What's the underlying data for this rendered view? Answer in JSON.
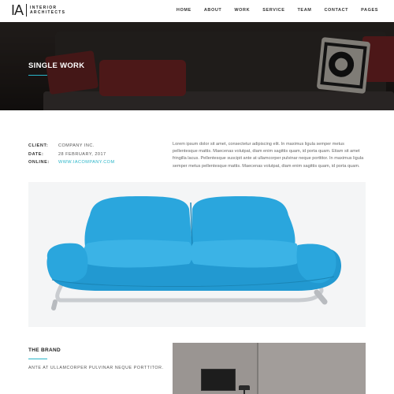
{
  "header": {
    "logo_mark": "IA",
    "logo_line1": "INTERIOR",
    "logo_line2": "ARCHITECTS",
    "nav": [
      "HOME",
      "ABOUT",
      "WORK",
      "SERVICE",
      "TEAM",
      "CONTACT",
      "PAGES"
    ]
  },
  "hero": {
    "title": "SINGLE WORK"
  },
  "project": {
    "client_label": "CLIENT:",
    "client_value": "COMPANY INC.",
    "date_label": "DATE:",
    "date_value": "28 FEBRUARY, 2017",
    "online_label": "ONLINE:",
    "online_value": "WWW.IACOMPANY.COM",
    "description": "Lorem ipsum dolor sit amet, consectetur adipiscing elit. In maximus ligula semper metus pellentesque mattis. Maecenas volutpat, diam enim sagittis quam, id porta quam. Etiam sit amet fringilla lacus. Pellentesque suscipit ante at ullamcorper pulvinar neque porttitor. In maximus ligula semper metus pellentesque mattis. Maecenas volutpat, diam enim sagittis quam, id porta quam."
  },
  "brand": {
    "title": "THE BRAND",
    "subtitle": "ANTE AT ULLAMCORPER PULVINAR NEQUE PORTTITOR."
  },
  "colors": {
    "accent": "#29b5c8",
    "sofa_blue": "#2aa6dd"
  },
  "icons": {
    "product": "blue-sofa-image",
    "hero": "living-room-photo",
    "room": "room-photo"
  }
}
